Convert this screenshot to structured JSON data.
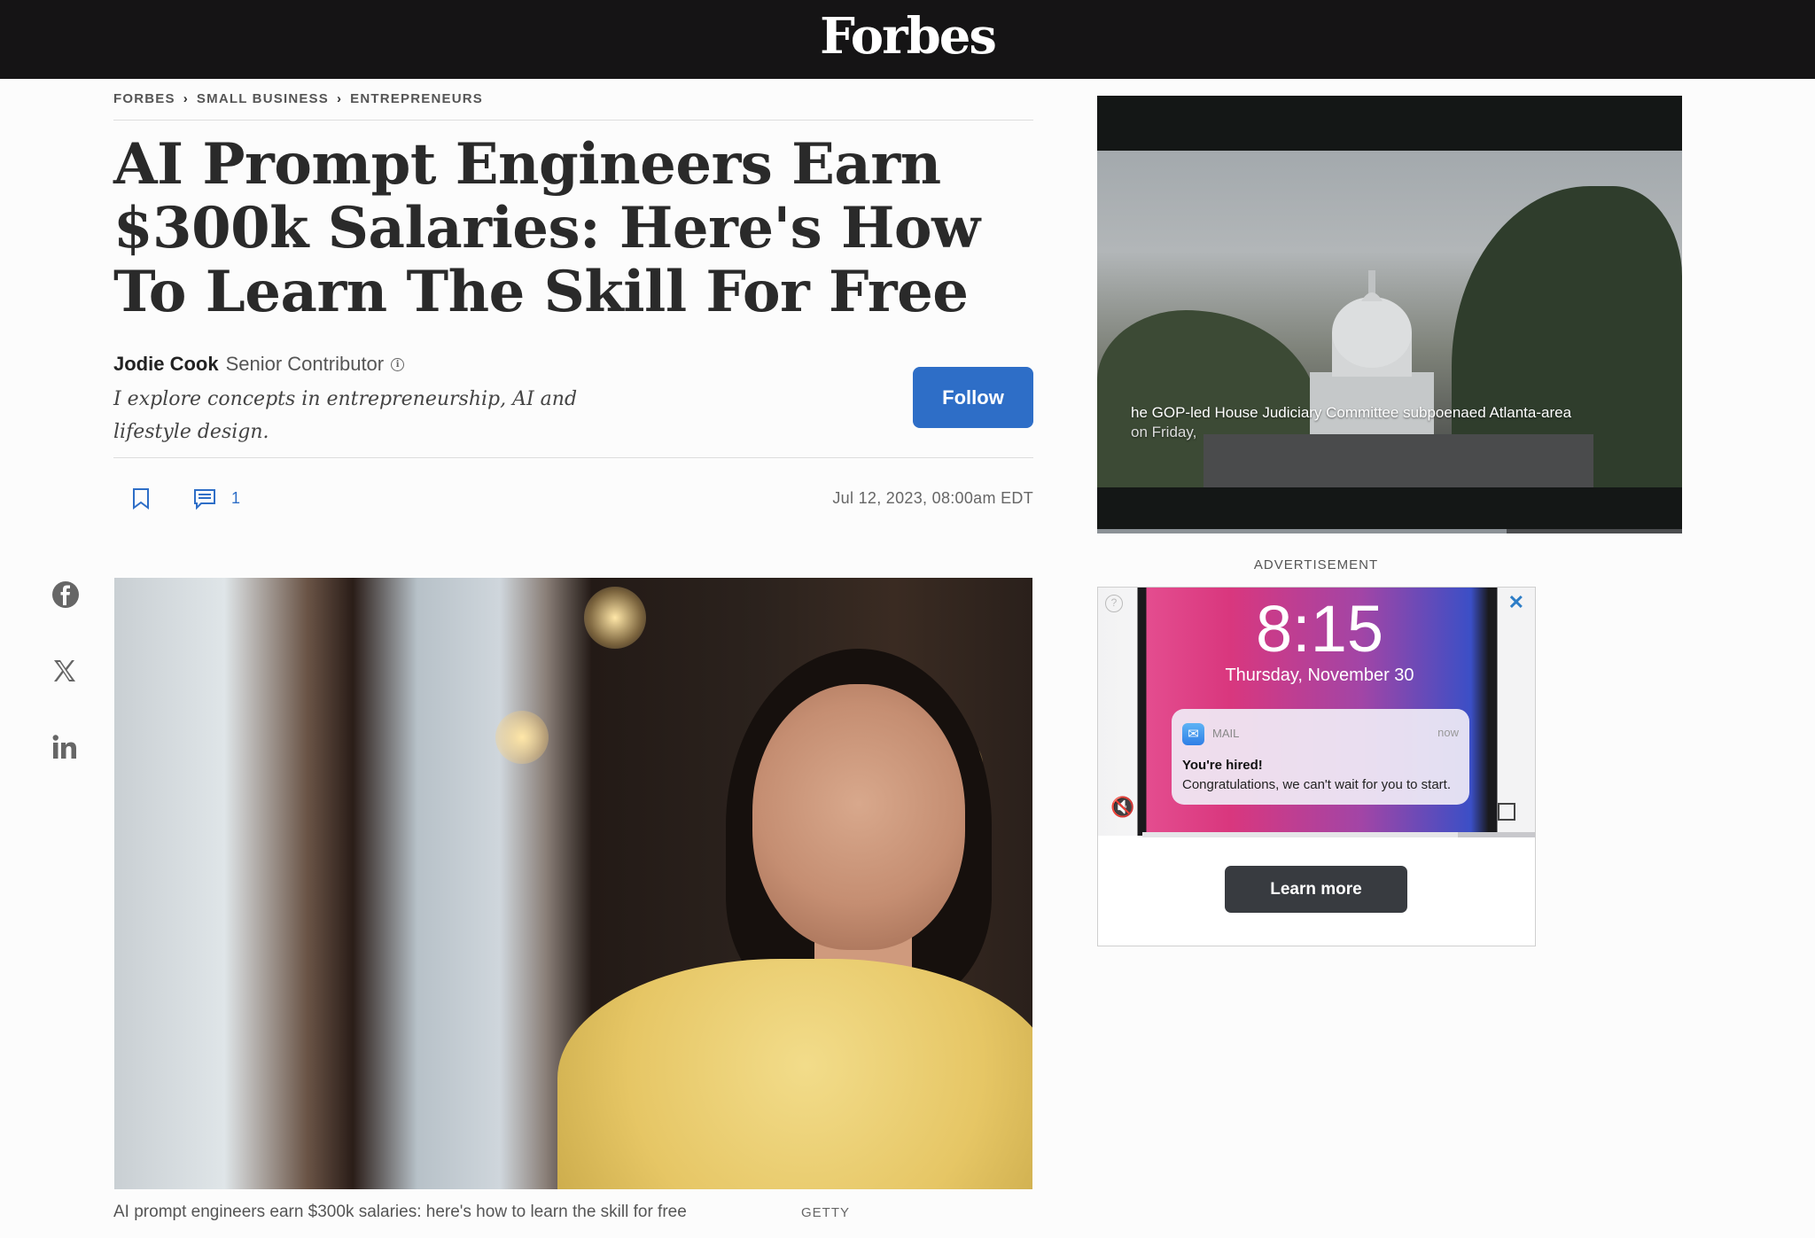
{
  "site": {
    "logo": "Forbes"
  },
  "breadcrumb": [
    "FORBES",
    "SMALL BUSINESS",
    "ENTREPRENEURS"
  ],
  "article": {
    "headline": "AI Prompt Engineers Earn $300k Salaries: Here's How To Learn The Skill For Free",
    "author_name": "Jodie Cook",
    "author_role": "Senior Contributor",
    "author_bio": "I explore concepts in entrepreneurship, AI and lifestyle design.",
    "follow_label": "Follow",
    "comment_count": "1",
    "date": "Jul 12, 2023, 08:00am EDT",
    "image_caption": "AI prompt engineers earn $300k salaries: here's how to learn the skill for free",
    "image_credit": "GETTY"
  },
  "social": [
    "facebook-icon",
    "x-icon",
    "linkedin-icon"
  ],
  "video": {
    "caption_line1": "he GOP-led House Judiciary Committee subpoenaed Atlanta-area",
    "caption_line2": "on Friday,",
    "progress": 0.7
  },
  "ad": {
    "label": "ADVERTISEMENT",
    "clock": "8:15",
    "date": "Thursday, November 30",
    "app": "MAIL",
    "time": "now",
    "title": "You're hired!",
    "body": "Congratulations, we can't wait for you to start.",
    "close": "✕",
    "help": "?",
    "mute": "🔇",
    "cta": "Learn more",
    "progress": 0.8
  },
  "colors": {
    "topbar": "#151415",
    "accent": "#2e6ec7",
    "cta": "#383b40"
  }
}
